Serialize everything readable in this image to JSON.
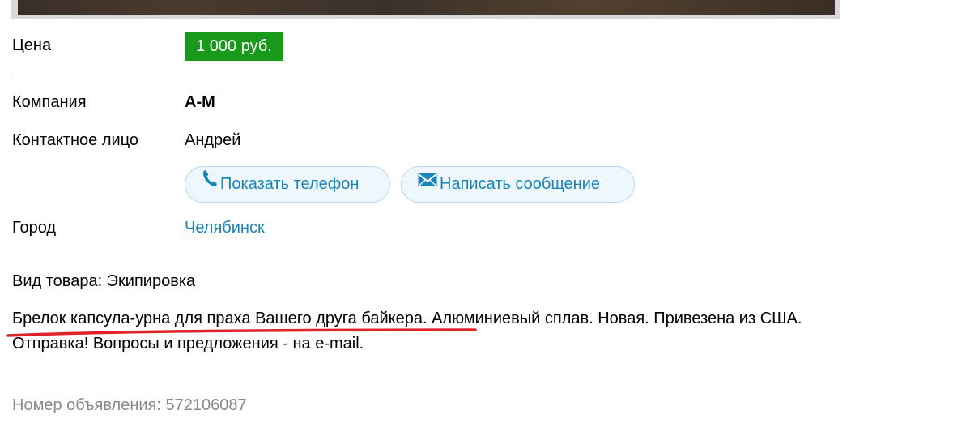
{
  "price": {
    "label": "Цена",
    "value": "1 000 руб.",
    "badge_color": "#1a9a1a"
  },
  "company": {
    "label": "Компания",
    "value": "А-М"
  },
  "contact": {
    "label": "Контактное лицо",
    "value": "Андрей"
  },
  "actions": {
    "show_phone": {
      "label": "Показать телефон",
      "icon": "phone-icon"
    },
    "send_message": {
      "label": "Написать сообщение",
      "icon": "envelope-icon"
    }
  },
  "city": {
    "label": "Город",
    "value": "Челябинск"
  },
  "description": {
    "product_type": "Вид товара: Экипировка",
    "line1": "Брелок капсула-урна для праха Вашего друга байкера. Алюминиевый сплав. Новая. Привезена из США.",
    "line2": "Отправка! Вопросы и предложения - на e-mail."
  },
  "ad_number": "Номер объявления: 572106087",
  "colors": {
    "link": "#1a83b8",
    "button_bg": "#eef7fc",
    "annotation_underline": "#e0222a",
    "muted_text": "#8a8a8a"
  }
}
